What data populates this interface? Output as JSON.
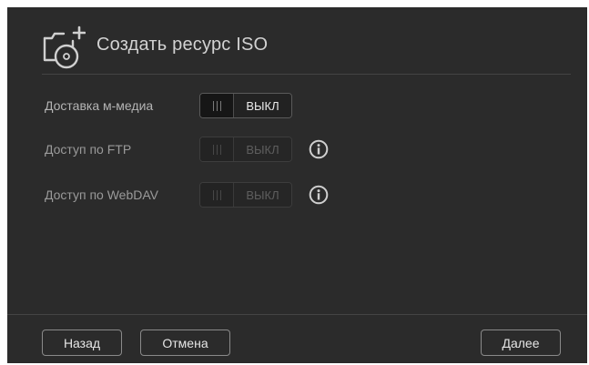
{
  "dialog": {
    "title": "Создать ресурс ISO",
    "header_icon": "camera-disc-add-icon"
  },
  "settings": [
    {
      "label": "Доставка м-медиа",
      "toggle_text": "ВЫКЛ",
      "state": "off",
      "enabled": true,
      "info_icon": false
    },
    {
      "label": "Доступ по FTP",
      "toggle_text": "ВЫКЛ",
      "state": "off",
      "enabled": false,
      "info_icon": true
    },
    {
      "label": "Доступ по WebDAV",
      "toggle_text": "ВЫКЛ",
      "state": "off",
      "enabled": false,
      "info_icon": true
    }
  ],
  "footer": {
    "back_label": "Назад",
    "cancel_label": "Отмена",
    "next_label": "Далее"
  },
  "colors": {
    "dialog_background": "#2b2b2b",
    "title_text": "#d2d2d2",
    "label_text": "#b4b4b4",
    "button_border": "#8a8a8a"
  }
}
